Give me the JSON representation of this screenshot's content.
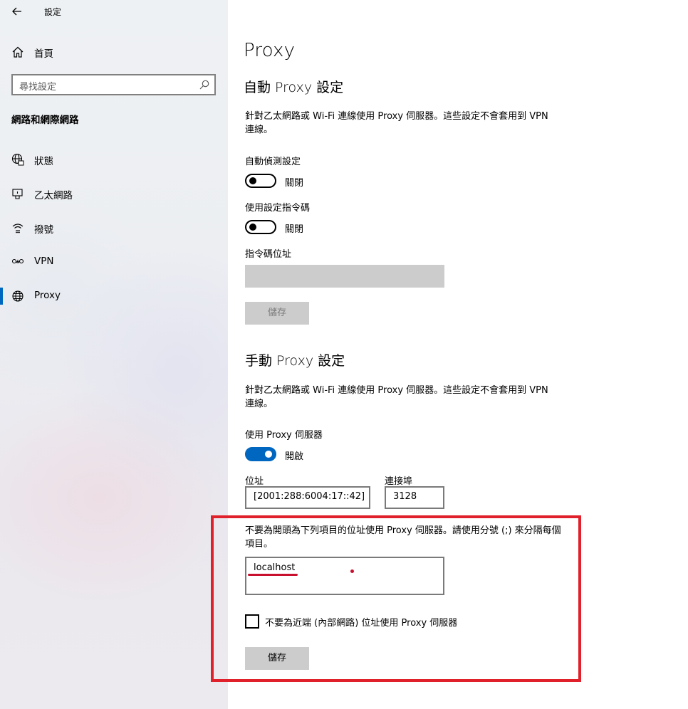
{
  "app": {
    "title": "設定"
  },
  "sidebar": {
    "home_label": "首頁",
    "search_placeholder": "尋找設定",
    "section_title": "網路和網際網路",
    "items": [
      {
        "label": "狀態",
        "icon": "globe-status-icon"
      },
      {
        "label": "乙太網路",
        "icon": "ethernet-icon"
      },
      {
        "label": "撥號",
        "icon": "dialup-icon"
      },
      {
        "label": "VPN",
        "icon": "vpn-icon"
      },
      {
        "label": "Proxy",
        "icon": "globe-icon",
        "active": true
      }
    ],
    "accent_color": "#0067c0"
  },
  "main": {
    "page_title": "Proxy",
    "auto": {
      "heading": "自動 Proxy 設定",
      "description": "針對乙太網路或 Wi-Fi 連線使用 Proxy 伺服器。這些設定不會套用到 VPN 連線。",
      "auto_detect_label": "自動偵測設定",
      "auto_detect_state": "關閉",
      "script_label": "使用設定指令碼",
      "script_state": "關閉",
      "script_address_label": "指令碼位址",
      "save_label": "儲存"
    },
    "manual": {
      "heading": "手動 Proxy 設定",
      "description": "針對乙太網路或 Wi-Fi 連線使用 Proxy 伺服器。這些設定不會套用到 VPN 連線。",
      "use_proxy_label": "使用 Proxy 伺服器",
      "use_proxy_state": "開啟",
      "address_label": "位址",
      "address_value": "[2001:288:6004:17::42]",
      "port_label": "連接埠",
      "port_value": "3128",
      "exceptions_description": "不要為開頭為下列項目的位址使用 Proxy 伺服器。請使用分號 (;) 來分隔每個項目。",
      "exceptions_value": "localhost",
      "local_bypass_label": "不要為近端 (內部網路) 位址使用 Proxy 伺服器",
      "save_label": "儲存"
    },
    "highlight_color": "#e0202a"
  }
}
